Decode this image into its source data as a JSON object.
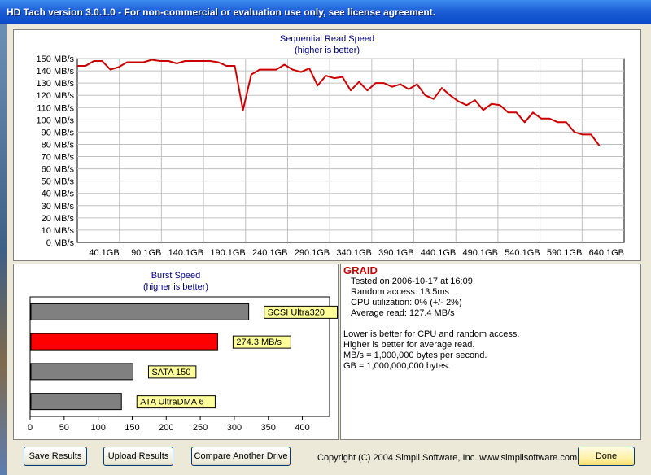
{
  "window": {
    "title": "HD Tach version 3.0.1.0  - For non-commercial or evaluation use only, see license agreement."
  },
  "sequential_chart": {
    "title": "Sequential Read Speed",
    "subtitle": "(higher is better)"
  },
  "burst_chart": {
    "title": "Burst Speed",
    "subtitle": "(higher is better)"
  },
  "chart_data": [
    {
      "type": "line",
      "title": "Sequential Read Speed",
      "subtitle": "(higher is better)",
      "ylim": [
        0,
        150
      ],
      "xlim": [
        0,
        660
      ],
      "y_tick_labels": [
        "0 MB/s",
        "10 MB/s",
        "20 MB/s",
        "30 MB/s",
        "40 MB/s",
        "50 MB/s",
        "60 MB/s",
        "70 MB/s",
        "80 MB/s",
        "90 MB/s",
        "100 MB/s",
        "110 MB/s",
        "120 MB/s",
        "130 MB/s",
        "140 MB/s",
        "150 MB/s"
      ],
      "x_tick_labels": [
        "40.1GB",
        "90.1GB",
        "140.1GB",
        "190.1GB",
        "240.1GB",
        "290.1GB",
        "340.1GB",
        "390.1GB",
        "440.1GB",
        "490.1GB",
        "540.1GB",
        "590.1GB",
        "640.1GB"
      ],
      "line_color": "#cc0000",
      "grid": true,
      "x": [
        0,
        10,
        20,
        30,
        40,
        50,
        60,
        70,
        80,
        90,
        100,
        110,
        120,
        130,
        140,
        150,
        160,
        170,
        180,
        190,
        200,
        210,
        220,
        230,
        240,
        250,
        260,
        270,
        280,
        290,
        300,
        310,
        320,
        330,
        340,
        350,
        360,
        370,
        380,
        390,
        400,
        410,
        420,
        430,
        440,
        450,
        460,
        470,
        480,
        490,
        500,
        510,
        520,
        530,
        540,
        550,
        560,
        570,
        580,
        590,
        600,
        610,
        620,
        630,
        640,
        650,
        660
      ],
      "values": [
        144,
        144,
        148,
        148,
        141,
        143,
        147,
        147,
        147,
        149,
        148,
        148,
        146,
        148,
        148,
        148,
        148,
        147,
        144,
        144,
        108,
        137,
        141,
        141,
        141,
        145,
        141,
        139,
        142,
        128,
        136,
        134,
        135,
        124,
        131,
        124,
        130,
        130,
        127,
        129,
        125,
        129,
        120,
        117,
        126,
        120,
        115,
        112,
        116,
        108,
        113,
        112,
        106,
        106,
        98,
        106,
        101,
        101,
        98,
        98,
        90,
        88,
        88,
        79
      ]
    },
    {
      "type": "bar",
      "title": "Burst Speed",
      "subtitle": "(higher is better)",
      "orientation": "horizontal",
      "categories": [
        "SCSI Ultra320",
        "274.3 MB/s",
        "SATA 150",
        "ATA UltraDMA 6"
      ],
      "values": [
        320,
        274.3,
        150,
        133
      ],
      "colors": [
        "#808080",
        "#ff0000",
        "#808080",
        "#808080"
      ],
      "xlim": [
        0,
        440
      ],
      "x_tick_labels": [
        "0",
        "50",
        "100",
        "150",
        "200",
        "250",
        "300",
        "350",
        "400"
      ]
    }
  ],
  "results": {
    "drive_name": "GRAID",
    "tested_on": "Tested on 2006-10-17 at 16:09",
    "random_access": "Random access: 13.5ms",
    "cpu_utilization": "CPU utilization: 0% (+/- 2%)",
    "average_read": "Average read: 127.4 MB/s",
    "note1": "Lower is better for CPU and random access.",
    "note2": "Higher is better for average read.",
    "note3": "MB/s = 1,000,000 bytes per second.",
    "note4": "GB = 1,000,000,000 bytes."
  },
  "buttons": {
    "save": "Save Results",
    "upload": "Upload Results",
    "compare": "Compare Another Drive",
    "done": "Done"
  },
  "footer": {
    "copyright": "Copyright (C) 2004 Simpli Software, Inc. www.simplisoftware.com"
  }
}
